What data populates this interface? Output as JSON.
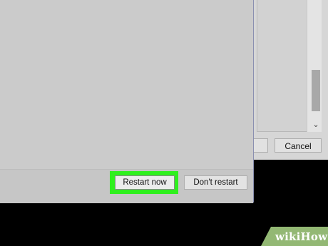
{
  "background_window": {
    "partial_button_label": "",
    "cancel_label": "Cancel",
    "scroll_arrow_icon": "chevron-down-icon"
  },
  "dialog": {
    "restart_now_label": "Restart now",
    "dont_restart_label": "Don't restart",
    "highlight_color": "#2ff01e"
  },
  "watermark": {
    "brand": "wikiHow"
  }
}
